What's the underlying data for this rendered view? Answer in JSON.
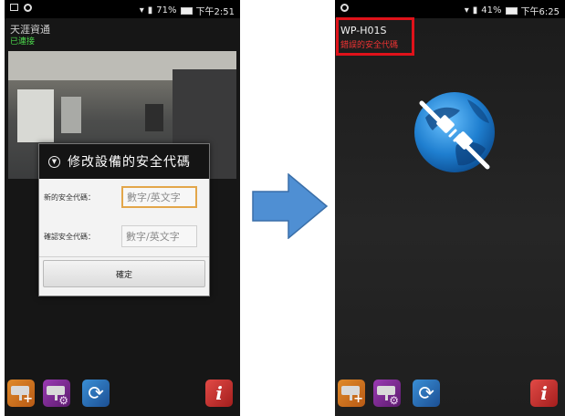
{
  "left_screen": {
    "status_bar": {
      "battery_text": "71%",
      "time": "下午2:51"
    },
    "device": {
      "name": "天涯資通",
      "status": "已連接"
    },
    "dialog": {
      "title": "修改設備的安全代碼",
      "new_code_label": "新的安全代碼：",
      "new_code_placeholder": "數字/英文字",
      "confirm_code_label": "確認安全代碼：",
      "confirm_code_placeholder": "數字/英文字",
      "ok_label": "確定"
    }
  },
  "right_screen": {
    "status_bar": {
      "battery_text": "41%",
      "time": "下午6:25"
    },
    "device": {
      "name": "WP-H01S",
      "status": "錯誤的安全代碼"
    },
    "center_icon": "disconnected-plug-globe-icon"
  },
  "toolbar_icons": [
    "add-camera-icon",
    "camera-settings-icon",
    "refresh-icon",
    "info-icon"
  ],
  "colors": {
    "status_ok": "#4cd84c",
    "status_error": "#ee3333",
    "highlight_box": "#e0121a",
    "input_focus": "#e3a64a",
    "arrow": "#4f8fd3"
  }
}
